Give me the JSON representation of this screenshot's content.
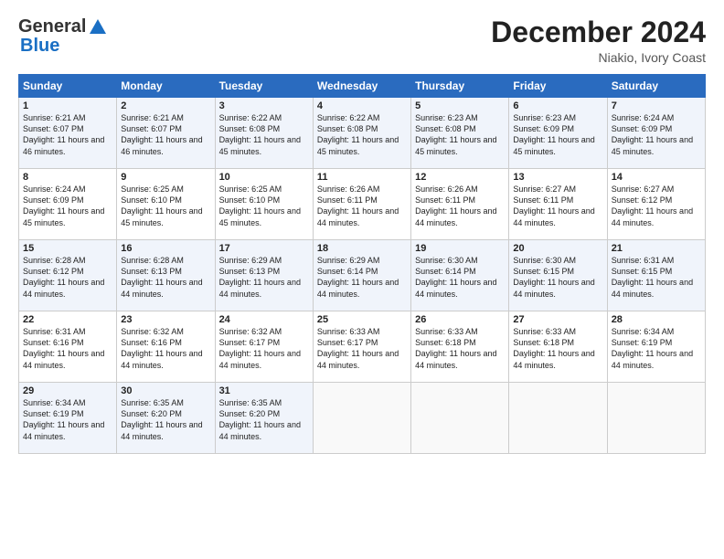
{
  "header": {
    "logo_general": "General",
    "logo_blue": "Blue",
    "month_title": "December 2024",
    "location": "Niakio, Ivory Coast"
  },
  "days_of_week": [
    "Sunday",
    "Monday",
    "Tuesday",
    "Wednesday",
    "Thursday",
    "Friday",
    "Saturday"
  ],
  "weeks": [
    [
      {
        "day": "1",
        "sunrise": "6:21 AM",
        "sunset": "6:07 PM",
        "daylight": "11 hours and 46 minutes."
      },
      {
        "day": "2",
        "sunrise": "6:21 AM",
        "sunset": "6:07 PM",
        "daylight": "11 hours and 46 minutes."
      },
      {
        "day": "3",
        "sunrise": "6:22 AM",
        "sunset": "6:08 PM",
        "daylight": "11 hours and 45 minutes."
      },
      {
        "day": "4",
        "sunrise": "6:22 AM",
        "sunset": "6:08 PM",
        "daylight": "11 hours and 45 minutes."
      },
      {
        "day": "5",
        "sunrise": "6:23 AM",
        "sunset": "6:08 PM",
        "daylight": "11 hours and 45 minutes."
      },
      {
        "day": "6",
        "sunrise": "6:23 AM",
        "sunset": "6:09 PM",
        "daylight": "11 hours and 45 minutes."
      },
      {
        "day": "7",
        "sunrise": "6:24 AM",
        "sunset": "6:09 PM",
        "daylight": "11 hours and 45 minutes."
      }
    ],
    [
      {
        "day": "8",
        "sunrise": "6:24 AM",
        "sunset": "6:09 PM",
        "daylight": "11 hours and 45 minutes."
      },
      {
        "day": "9",
        "sunrise": "6:25 AM",
        "sunset": "6:10 PM",
        "daylight": "11 hours and 45 minutes."
      },
      {
        "day": "10",
        "sunrise": "6:25 AM",
        "sunset": "6:10 PM",
        "daylight": "11 hours and 45 minutes."
      },
      {
        "day": "11",
        "sunrise": "6:26 AM",
        "sunset": "6:11 PM",
        "daylight": "11 hours and 44 minutes."
      },
      {
        "day": "12",
        "sunrise": "6:26 AM",
        "sunset": "6:11 PM",
        "daylight": "11 hours and 44 minutes."
      },
      {
        "day": "13",
        "sunrise": "6:27 AM",
        "sunset": "6:11 PM",
        "daylight": "11 hours and 44 minutes."
      },
      {
        "day": "14",
        "sunrise": "6:27 AM",
        "sunset": "6:12 PM",
        "daylight": "11 hours and 44 minutes."
      }
    ],
    [
      {
        "day": "15",
        "sunrise": "6:28 AM",
        "sunset": "6:12 PM",
        "daylight": "11 hours and 44 minutes."
      },
      {
        "day": "16",
        "sunrise": "6:28 AM",
        "sunset": "6:13 PM",
        "daylight": "11 hours and 44 minutes."
      },
      {
        "day": "17",
        "sunrise": "6:29 AM",
        "sunset": "6:13 PM",
        "daylight": "11 hours and 44 minutes."
      },
      {
        "day": "18",
        "sunrise": "6:29 AM",
        "sunset": "6:14 PM",
        "daylight": "11 hours and 44 minutes."
      },
      {
        "day": "19",
        "sunrise": "6:30 AM",
        "sunset": "6:14 PM",
        "daylight": "11 hours and 44 minutes."
      },
      {
        "day": "20",
        "sunrise": "6:30 AM",
        "sunset": "6:15 PM",
        "daylight": "11 hours and 44 minutes."
      },
      {
        "day": "21",
        "sunrise": "6:31 AM",
        "sunset": "6:15 PM",
        "daylight": "11 hours and 44 minutes."
      }
    ],
    [
      {
        "day": "22",
        "sunrise": "6:31 AM",
        "sunset": "6:16 PM",
        "daylight": "11 hours and 44 minutes."
      },
      {
        "day": "23",
        "sunrise": "6:32 AM",
        "sunset": "6:16 PM",
        "daylight": "11 hours and 44 minutes."
      },
      {
        "day": "24",
        "sunrise": "6:32 AM",
        "sunset": "6:17 PM",
        "daylight": "11 hours and 44 minutes."
      },
      {
        "day": "25",
        "sunrise": "6:33 AM",
        "sunset": "6:17 PM",
        "daylight": "11 hours and 44 minutes."
      },
      {
        "day": "26",
        "sunrise": "6:33 AM",
        "sunset": "6:18 PM",
        "daylight": "11 hours and 44 minutes."
      },
      {
        "day": "27",
        "sunrise": "6:33 AM",
        "sunset": "6:18 PM",
        "daylight": "11 hours and 44 minutes."
      },
      {
        "day": "28",
        "sunrise": "6:34 AM",
        "sunset": "6:19 PM",
        "daylight": "11 hours and 44 minutes."
      }
    ],
    [
      {
        "day": "29",
        "sunrise": "6:34 AM",
        "sunset": "6:19 PM",
        "daylight": "11 hours and 44 minutes."
      },
      {
        "day": "30",
        "sunrise": "6:35 AM",
        "sunset": "6:20 PM",
        "daylight": "11 hours and 44 minutes."
      },
      {
        "day": "31",
        "sunrise": "6:35 AM",
        "sunset": "6:20 PM",
        "daylight": "11 hours and 44 minutes."
      },
      null,
      null,
      null,
      null
    ]
  ]
}
